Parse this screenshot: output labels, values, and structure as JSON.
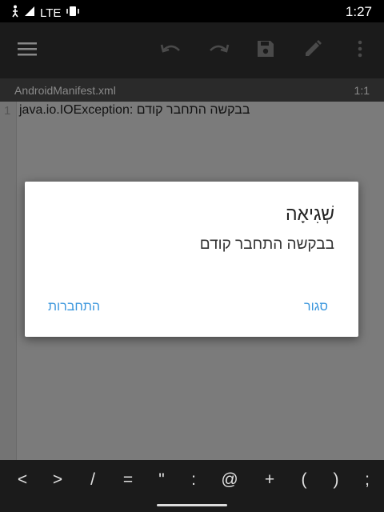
{
  "status_bar": {
    "network": "LTE",
    "time": "1:27",
    "icons": [
      "accessibility-icon",
      "signal-icon",
      "vibrate-icon"
    ]
  },
  "toolbar": {
    "icons": [
      "menu-icon",
      "undo-icon",
      "redo-icon",
      "save-icon",
      "edit-icon",
      "more-vert-icon"
    ]
  },
  "file_bar": {
    "filename": "AndroidManifest.xml",
    "cursor_position": "1:1"
  },
  "editor": {
    "line_number": "1",
    "line_text": "java.io.IOException: בבקשה התחבר קודם"
  },
  "dialog": {
    "title": "שְׁגִיאָה",
    "message": "בבקשה התחבר קודם",
    "button_close": "סגור",
    "button_connect": "התחברות"
  },
  "keys": [
    "<",
    ">",
    "/",
    "=",
    "\"",
    ":",
    "@",
    "+",
    "(",
    ")",
    ";"
  ],
  "colors": {
    "accent": "#3a96dd",
    "toolbar_bg": "#1b1b1b",
    "overlay": "#7a7a7a"
  }
}
